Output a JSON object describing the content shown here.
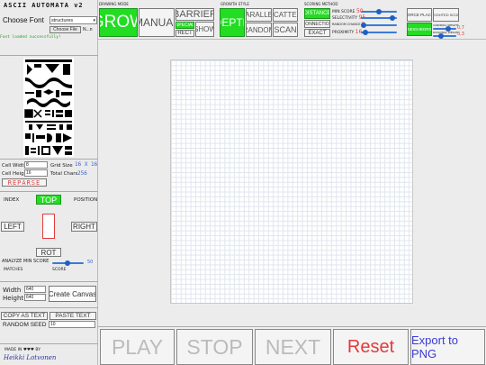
{
  "app": {
    "title": "ASCII AUTOMATA v2",
    "choose_font_label": "Choose Font",
    "font_select_value": "structures",
    "choose_file_button": "Choose File",
    "file_name": "N...n",
    "status": "Font loaded successfully!"
  },
  "cells": {
    "cell_width_label": "Cell Width",
    "cell_width_value": "8",
    "cell_height_label": "Cell Height",
    "cell_height_value": "16",
    "grid_size_label": "Grid Size",
    "grid_size_value": "16 X 16",
    "total_chars_label": "Total Chars",
    "total_chars_value": "256",
    "reparse_button": "REPARSE"
  },
  "index_panel": {
    "index_label": "INDEX",
    "position_label": "POSITION",
    "top_button": "TOP",
    "left_button": "LEFT",
    "right_button": "RIGHT",
    "rot_button": "ROT"
  },
  "analyze": {
    "label": "ANALYZE MIN SCORE",
    "value": "50",
    "matches_label": "MATCHES",
    "score_label": "SCORE"
  },
  "canvas_size": {
    "width_label": "Width",
    "width_value": "640",
    "height_label": "Height",
    "height_value": "640",
    "create_button": "Create Canvas"
  },
  "text_io": {
    "copy_button": "COPY AS TEXT",
    "paste_button": "PASTE TEXT",
    "random_seed_label": "RANDOM SEED",
    "random_seed_value": "10"
  },
  "credits": {
    "made_in": "MADE IN ♥♥♥ BY",
    "author": "Heikki Lotvonen"
  },
  "drawing_mode": {
    "title": "DRAWING MODE",
    "grow": "GROW",
    "manual": "MANUAL",
    "barrier": "BARRIER",
    "special": "SPECIAL",
    "rect": "RECT",
    "show": "SHOW"
  },
  "growth_style": {
    "title": "GROWTH STYLE",
    "depth": "DEPTH",
    "parallel": "PARALLEL",
    "scatter": "SCATTER",
    "random": "RANDOM",
    "scan": "SCAN"
  },
  "scoring": {
    "title": "SCORING METHOD",
    "distance": "DISTANCE",
    "connection": "CONNECTION",
    "exact": "EXACT",
    "min_score_label": "MIN SCORE",
    "min_score_value": "50",
    "min_score_fraction": 0.5,
    "selectivity_label": "SELECTIVITY",
    "selectivity_value": "95",
    "selectivity_fraction": 0.95,
    "random_chance_label": "RANDOM CHANCE",
    "random_chance_value": "0",
    "random_chance_fraction": 0.0,
    "proximity_label": "PROXIMITY",
    "proximity_value": "16",
    "proximity_fraction": 0.05
  },
  "weights": {
    "force_place": "FORCE PLACE",
    "weighted_score": "WEIGHTED SCORE",
    "neighbor_weight_label": "NEIGHBORS",
    "diagonal_weight_label": "DIAGONAL WEIGHT",
    "cardinal_weight_label": "CARDINAL WEIGHT",
    "cardinal_weight_value": "0,7",
    "cardinal_weight_fraction": 0.7,
    "diagonal_weight_value": "0,3",
    "diagonal_weight_fraction": 0.3
  },
  "controls": {
    "play": "PLAY",
    "stop": "STOP",
    "next": "NEXT",
    "reset": "Reset",
    "export": "Export to PNG"
  },
  "colors": {
    "accent_green": "#22dd22",
    "reset_red": "#e23b3b",
    "export_blue": "#3b3bd5",
    "slider_blue": "#3a7bd5"
  }
}
